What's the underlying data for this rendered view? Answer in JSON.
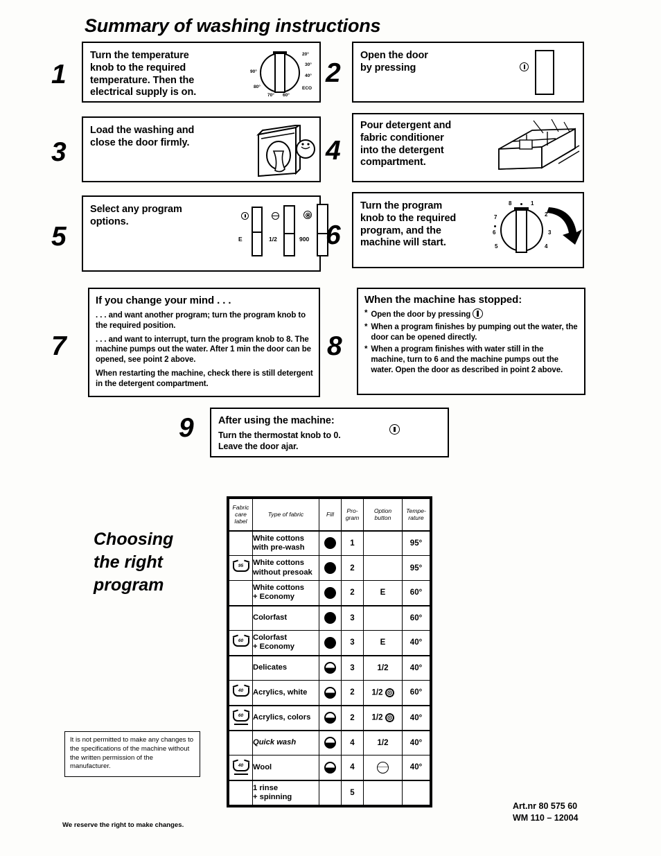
{
  "document": {
    "title": "Summary of washing instructions",
    "section_heading": "Choosing\nthe right\nprogram"
  },
  "steps": [
    {
      "number": "1",
      "text": "Turn the temperature\nknob to the required\ntemperature. Then the\nelectrical supply is on.",
      "figure": "temperature-knob"
    },
    {
      "number": "2",
      "text": "Open the door\nby pressing",
      "figure": "door-button"
    },
    {
      "number": "3",
      "text": "Load the washing and\nclose the door firmly.",
      "figure": "washing-machine"
    },
    {
      "number": "4",
      "text": "Pour detergent and\nfabric conditioner\ninto the detergent\ncompartment.",
      "figure": "detergent-drawer"
    },
    {
      "number": "5",
      "text": "Select any program\noptions.",
      "figure": "option-buttons"
    },
    {
      "number": "6",
      "text": "Turn the program\nknob to the required\nprogram, and the\nmachine will start.",
      "figure": "program-knob"
    },
    {
      "number": "7",
      "heading": "If you change your mind . . .",
      "paragraphs": [
        ". . . and want another program; turn the program knob to the required position.",
        ". . . and want to interrupt, turn the program knob to 8. The machine pumps out the water. After 1 min the door can be opened, see point 2 above.",
        "When restarting the machine, check there is still detergent in the detergent compartment."
      ]
    },
    {
      "number": "8",
      "heading": "When the machine has stopped:",
      "bullets": [
        "Open the door by pressing",
        "When a program finishes by pumping out the water, the door can be opened directly.",
        "When a program finishes with water still in the machine, turn to 6 and the machine pumps out the water. Open the door as described in point 2 above."
      ]
    },
    {
      "number": "9",
      "heading": "After using the machine:",
      "lines": [
        "Turn the thermostat knob to 0.",
        "Leave the door ajar."
      ]
    }
  ],
  "temperature_knob": {
    "ticks": [
      "20°",
      "30°",
      "40°",
      "ECO",
      "60°",
      "70°",
      "80°",
      "90°"
    ]
  },
  "program_knob": {
    "ticks": [
      "8",
      "1",
      "2",
      "3",
      "4",
      "5",
      "6",
      "7"
    ]
  },
  "option_buttons": [
    {
      "icon": "door-key-icon",
      "label": "E"
    },
    {
      "icon": "half-load-icon",
      "label": "1/2"
    },
    {
      "icon": "spin-speed-icon",
      "label": "900"
    }
  ],
  "program_table": {
    "headers": [
      "Fabric\ncare\nlabel",
      "Type of fabric",
      "Fill",
      "Pro-\ngram",
      "Option\nbutton",
      "Tempe-\nrature"
    ],
    "rows": [
      {
        "care_label": "",
        "fabric": "White cottons\nwith pre-wash",
        "fill": "full",
        "program": "1",
        "option": "",
        "option_icon": "",
        "temperature": "95°",
        "group_start": true
      },
      {
        "care_label": "95",
        "fabric": "White cottons\nwithout presoak",
        "fill": "full",
        "program": "2",
        "option": "",
        "option_icon": "",
        "temperature": "95°"
      },
      {
        "care_label": "",
        "fabric": "White cottons\n+ Economy",
        "fill": "full",
        "program": "2",
        "option": "E",
        "option_icon": "",
        "temperature": "60°"
      },
      {
        "care_label": "",
        "fabric": "Colorfast",
        "fill": "full",
        "program": "3",
        "option": "",
        "option_icon": "",
        "temperature": "60°",
        "group_start": true
      },
      {
        "care_label": "60",
        "fabric": "Colorfast\n+ Economy",
        "fill": "full",
        "program": "3",
        "option": "E",
        "option_icon": "",
        "temperature": "40°"
      },
      {
        "care_label": "",
        "fabric": "Delicates",
        "fill": "half",
        "program": "3",
        "option": "1/2",
        "option_icon": "",
        "temperature": "40°",
        "group_start": true
      },
      {
        "care_label": "40",
        "fabric": "Acrylics, white",
        "fill": "half",
        "program": "2",
        "option": "1/2",
        "option_icon": "spin",
        "temperature": "60°"
      },
      {
        "care_label": "60-underline",
        "fabric": "Acrylics, colors",
        "fill": "half",
        "program": "2",
        "option": "1/2",
        "option_icon": "spin",
        "temperature": "40°",
        "group_start": true
      },
      {
        "care_label": "",
        "fabric": "Quick wash",
        "fill": "half",
        "program": "4",
        "option": "1/2",
        "option_icon": "",
        "temperature": "40°",
        "italic": true,
        "group_start": true
      },
      {
        "care_label": "40-underline",
        "fabric": "Wool",
        "fill": "half",
        "program": "4",
        "option": "",
        "option_icon": "wool",
        "temperature": "40°"
      },
      {
        "care_label": "",
        "fabric": "1 rinse\n+ spinning",
        "fill": "",
        "program": "5",
        "option": "",
        "option_icon": "",
        "temperature": "",
        "group_start": true
      }
    ]
  },
  "disclaimer": "It is not permitted to make any changes to the specifications of the machine without the written permission of the manufacturer.",
  "footer": {
    "art_number": "Art.nr 80 575 60",
    "model_code": "WM 110 – 12004",
    "notice": "We reserve the right to make changes."
  }
}
